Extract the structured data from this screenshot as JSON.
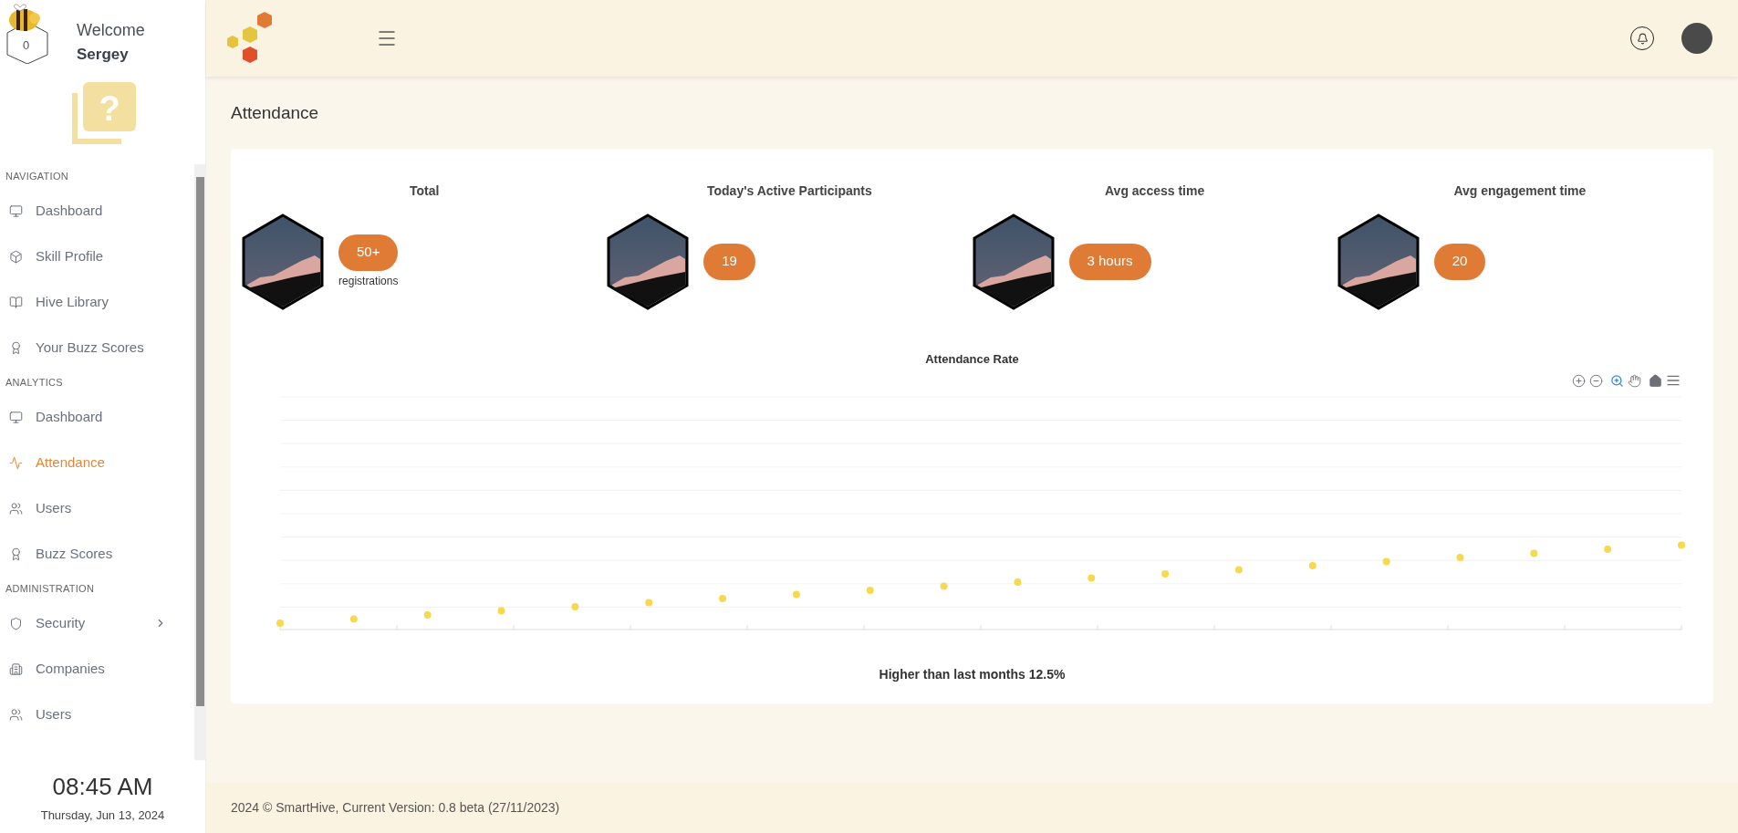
{
  "user": {
    "badge_count": "0",
    "greeting": "Welcome",
    "name": "Sergey"
  },
  "sidebar": {
    "sections": [
      {
        "heading": "NAVIGATION",
        "items": [
          {
            "label": "Dashboard",
            "selected": false,
            "kind": "link"
          },
          {
            "label": "Skill Profile",
            "selected": false,
            "kind": "link"
          },
          {
            "label": "Hive Library",
            "selected": false,
            "kind": "link"
          },
          {
            "label": "Your Buzz Scores",
            "selected": false,
            "kind": "link"
          }
        ]
      },
      {
        "heading": "ANALYTICS",
        "items": [
          {
            "label": "Dashboard",
            "selected": false,
            "kind": "link"
          },
          {
            "label": "Attendance",
            "selected": true,
            "kind": "link"
          },
          {
            "label": "Users",
            "selected": false,
            "kind": "link"
          },
          {
            "label": "Buzz Scores",
            "selected": false,
            "kind": "link"
          }
        ]
      },
      {
        "heading": "ADMINISTRATION",
        "items": [
          {
            "label": "Security",
            "selected": false,
            "kind": "group",
            "expanded": false
          },
          {
            "label": "Companies",
            "selected": false,
            "kind": "link"
          },
          {
            "label": "Users",
            "selected": false,
            "kind": "link"
          }
        ]
      }
    ]
  },
  "help_card": {
    "glyph": "?"
  },
  "clock": {
    "time": "08:45 AM",
    "date": "Thursday, Jun 13, 2024"
  },
  "page_title": "Attendance",
  "stats": [
    {
      "title": "Total",
      "value": "50+",
      "caption": "registrations"
    },
    {
      "title": "Today's Active Participants",
      "value": "19"
    },
    {
      "title": "Avg access time",
      "value": "3 hours"
    },
    {
      "title": "Avg engagement time",
      "value": "20"
    }
  ],
  "chart": {
    "title": "Attendance Rate",
    "summary": "Higher than last months 12.5%"
  },
  "footer": "2024 © SmartHive, Current Version: 0.8 beta (27/11/2023)"
}
